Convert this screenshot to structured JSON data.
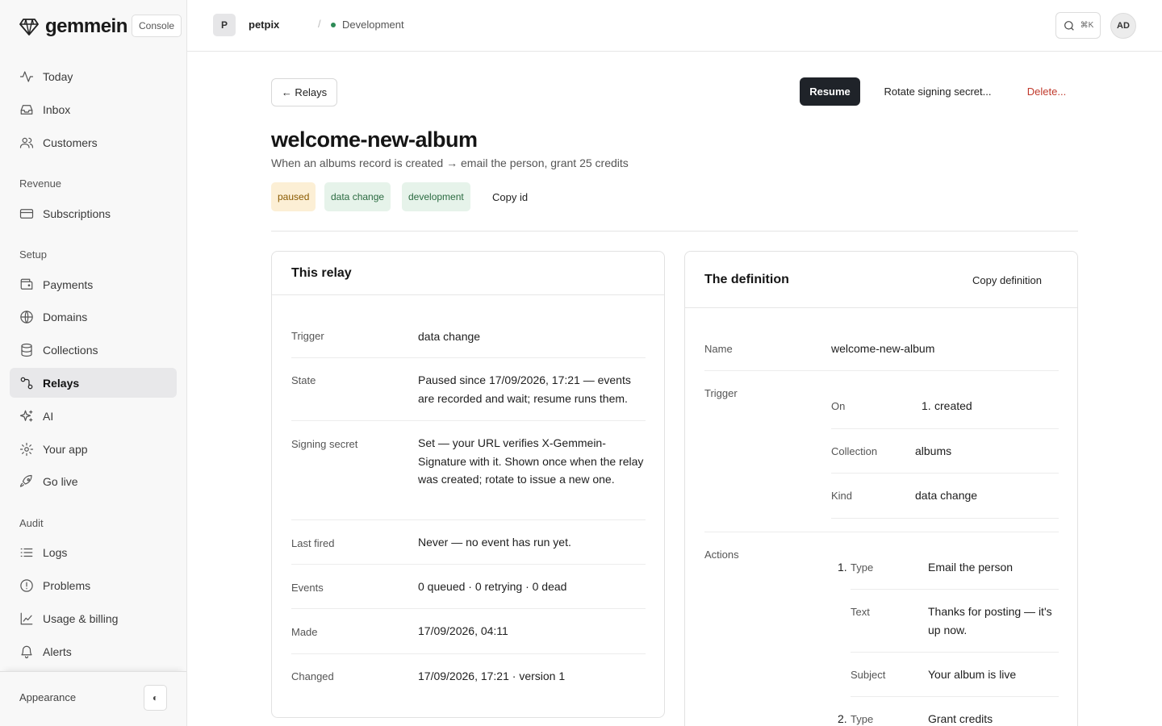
{
  "brand": {
    "name": "gemmein",
    "badge": "Console"
  },
  "sidebar": {
    "items": [
      {
        "label": "Today",
        "icon": "activity-icon"
      },
      {
        "label": "Inbox",
        "icon": "inbox-icon"
      },
      {
        "label": "Customers",
        "icon": "users-icon"
      }
    ],
    "revenue_heading": "Revenue",
    "revenue_items": [
      {
        "label": "Subscriptions",
        "icon": "credit-card-icon"
      }
    ],
    "setup_heading": "Setup",
    "setup_items": [
      {
        "label": "Payments",
        "icon": "wallet-icon"
      },
      {
        "label": "Domains",
        "icon": "globe-icon"
      },
      {
        "label": "Collections",
        "icon": "database-icon"
      },
      {
        "label": "Relays",
        "icon": "relay-icon",
        "active": true
      },
      {
        "label": "AI",
        "icon": "sparkles-icon"
      },
      {
        "label": "Your app",
        "icon": "gear-icon"
      },
      {
        "label": "Go live",
        "icon": "rocket-icon"
      }
    ],
    "audit_heading": "Audit",
    "audit_items": [
      {
        "label": "Logs",
        "icon": "list-icon"
      },
      {
        "label": "Problems",
        "icon": "alert-circle-icon"
      },
      {
        "label": "Usage & billing",
        "icon": "chart-icon"
      },
      {
        "label": "Alerts",
        "icon": "bell-icon"
      }
    ],
    "footer": {
      "appearance_label": "Appearance",
      "toggle_glyph": "◐"
    }
  },
  "topbar": {
    "project_initial": "P",
    "project_name": "petpix",
    "separator": "/",
    "environment": "Development",
    "env_color": "#2e8b57",
    "search_shortcut": "⌘K",
    "user_initials": "AD"
  },
  "actions": {
    "back_label": "← Relays",
    "resume_label": "Resume",
    "rotate_label": "Rotate signing secret...",
    "delete_label": "Delete..."
  },
  "relay": {
    "title": "welcome-new-album",
    "subtitle": "When an albums record is created → email the person, grant 25 credits",
    "tags": {
      "state": "paused",
      "trigger": "data change",
      "environment": "development"
    },
    "copy_id_label": "Copy id"
  },
  "this_relay": {
    "heading": "This relay",
    "rows": [
      {
        "label": "Trigger",
        "value": "data change"
      },
      {
        "label": "State",
        "value": "Paused since 17/09/2026, 17:21 — events are recorded and wait; resume runs them."
      },
      {
        "label": "Signing secret",
        "value": "Set — your URL verifies X-Gemmein-Signature with it. Shown once when the relay was created; rotate to issue a new one."
      },
      {
        "label": "Last fired",
        "value": "Never — no event has run yet."
      },
      {
        "label": "Events",
        "value": "0 queued · 0 retrying · 0 dead"
      },
      {
        "label": "Made",
        "value": "17/09/2026, 04:11"
      },
      {
        "label": "Changed",
        "value": "17/09/2026, 17:21 · version 1"
      }
    ]
  },
  "definition": {
    "heading": "The definition",
    "copy_label": "Copy definition",
    "name_label": "Name",
    "name_value": "welcome-new-album",
    "trigger_label": "Trigger",
    "trigger": {
      "on_label": "On",
      "on_num": "1.",
      "on_value": "created",
      "collection_label": "Collection",
      "collection_value": "albums",
      "kind_label": "Kind",
      "kind_value": "data change"
    },
    "actions_label": "Actions",
    "actions": [
      {
        "num": "1.",
        "type_label": "Type",
        "type_value": "Email the person",
        "text_label": "Text",
        "text_value": "Thanks for posting — it's up now.",
        "subject_label": "Subject",
        "subject_value": "Your album is live"
      },
      {
        "num": "2.",
        "type_label": "Type",
        "type_value": "Grant credits"
      }
    ]
  }
}
